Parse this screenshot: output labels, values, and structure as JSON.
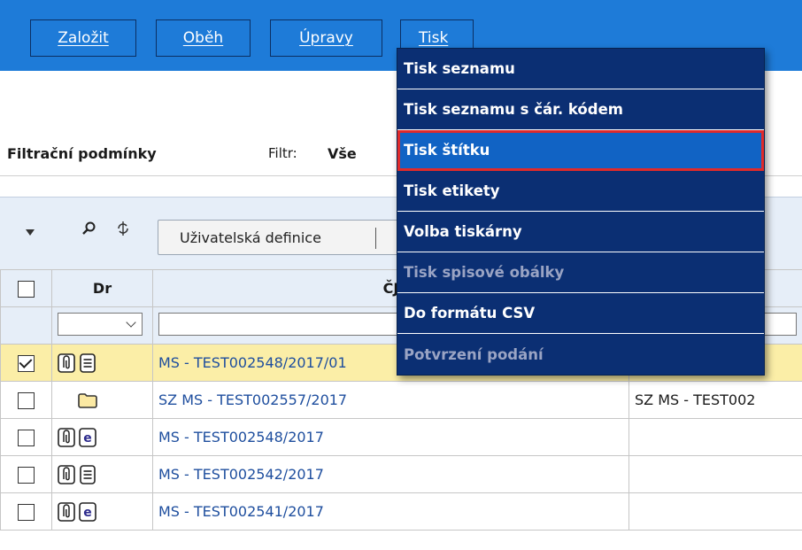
{
  "toolbar": {
    "zalozit": "Založit",
    "obeh": "Oběh",
    "upravy": "Úpravy",
    "tisk": "Tisk"
  },
  "filter": {
    "label": "Filtrační podmínky",
    "key": "Filtr:",
    "value": "Vše"
  },
  "panel": {
    "user_definition": "Uživatelská definice",
    "col_dr": "Dr",
    "col_cj": "ČJ"
  },
  "rows": [
    {
      "checked": true,
      "icons": [
        "clip-icon",
        "document-icon"
      ],
      "cj": "MS - TEST002548/2017/01",
      "col3": ""
    },
    {
      "checked": false,
      "icons": [
        "folder-icon"
      ],
      "cj": "SZ MS - TEST002557/2017",
      "col3": "SZ MS - TEST002"
    },
    {
      "checked": false,
      "icons": [
        "clip-icon",
        "e-icon"
      ],
      "cj": "MS - TEST002548/2017",
      "col3": ""
    },
    {
      "checked": false,
      "icons": [
        "clip-icon",
        "document-icon"
      ],
      "cj": "MS - TEST002542/2017",
      "col3": ""
    },
    {
      "checked": false,
      "icons": [
        "clip-icon",
        "e-icon"
      ],
      "cj": "MS - TEST002541/2017",
      "col3": ""
    }
  ],
  "menu": {
    "items": [
      {
        "label": "Tisk seznamu",
        "state": "enabled"
      },
      {
        "label": "Tisk seznamu s čár. kódem",
        "state": "enabled"
      },
      {
        "label": "Tisk štítku",
        "state": "highlighted"
      },
      {
        "label": "Tisk etikety",
        "state": "enabled"
      },
      {
        "label": "Volba tiskárny",
        "state": "enabled"
      },
      {
        "label": "Tisk spisové obálky",
        "state": "disabled"
      },
      {
        "label": "Do formátu CSV",
        "state": "enabled"
      },
      {
        "label": "Potvrzení podání",
        "state": "disabled"
      }
    ]
  },
  "colors": {
    "toolbar_bg": "#1e7bd8",
    "menu_bg": "#0b2f73",
    "highlight_border": "#e02a2a",
    "selected_row": "#fbeea7",
    "link": "#1e4e9e"
  }
}
